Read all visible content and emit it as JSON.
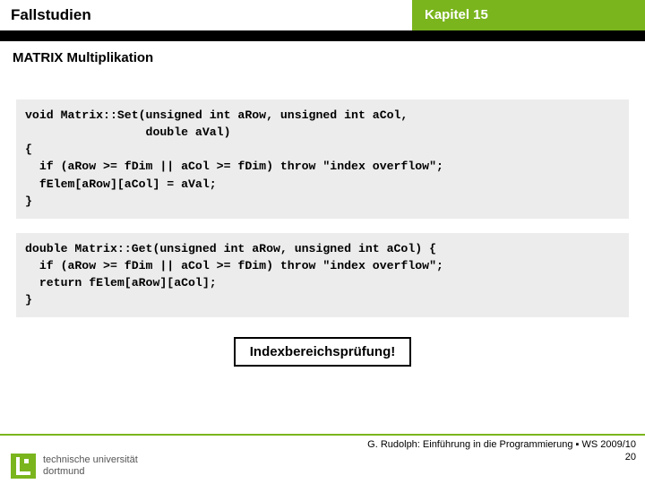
{
  "header": {
    "left": "Fallstudien",
    "right": "Kapitel 15"
  },
  "subtitle": "MATRIX Multiplikation",
  "code1": "void Matrix::Set(unsigned int aRow, unsigned int aCol,\n                 double aVal)\n{\n  if (aRow >= fDim || aCol >= fDim) throw \"index overflow\";\n  fElem[aRow][aCol] = aVal;\n}",
  "code2": "double Matrix::Get(unsigned int aRow, unsigned int aCol) {\n  if (aRow >= fDim || aCol >= fDim) throw \"index overflow\";\n  return fElem[aRow][aCol];\n}",
  "callout": "Indexbereichsprüfung!",
  "footer": {
    "line": "G. Rudolph: Einführung in die Programmierung ▪ WS 2009/10",
    "page": "20",
    "logo_line1": "technische universität",
    "logo_line2": "dortmund"
  }
}
